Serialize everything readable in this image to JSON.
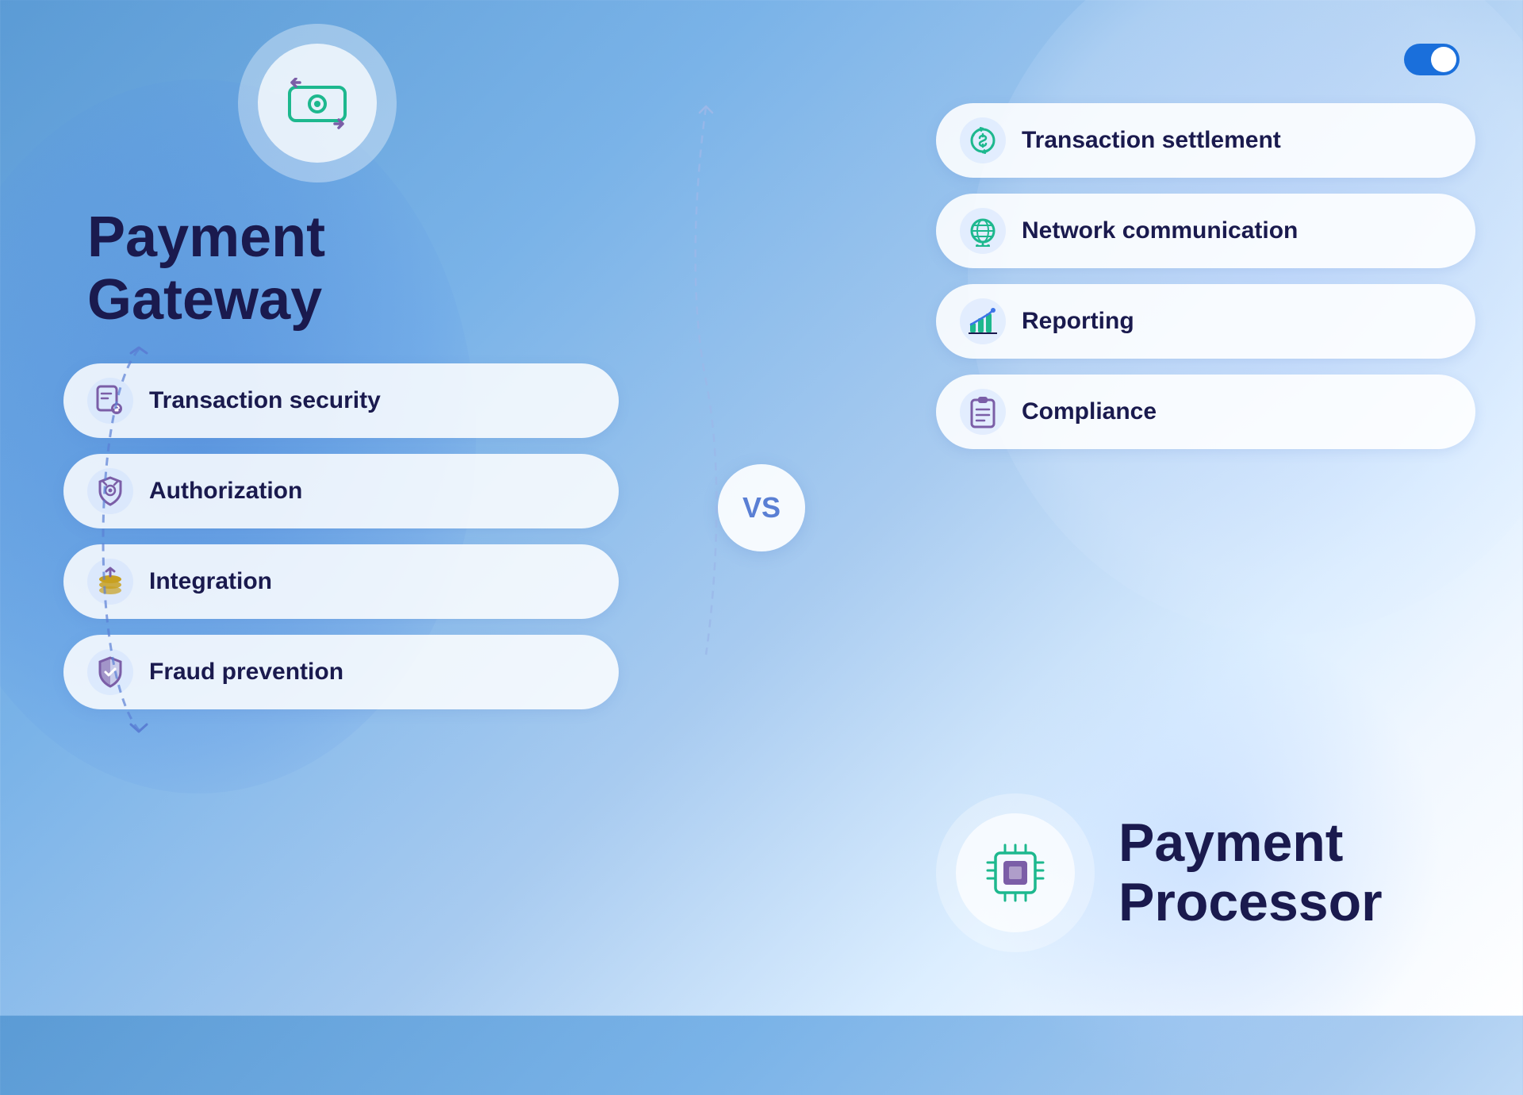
{
  "toggle": {
    "label": "toggle-icon"
  },
  "left": {
    "title_line1": "Payment",
    "title_line2": "Gateway",
    "items": [
      {
        "label": "Transaction security",
        "icon": "document-lock-icon",
        "icon_color": "#7b5ea7"
      },
      {
        "label": "Authorization",
        "icon": "shield-check-icon",
        "icon_color": "#7b5ea7"
      },
      {
        "label": "Integration",
        "icon": "layers-up-icon",
        "icon_color": "#7b5ea7"
      },
      {
        "label": "Fraud prevention",
        "icon": "shield-half-icon",
        "icon_color": "#7b5ea7"
      }
    ]
  },
  "vs_label": "VS",
  "right": {
    "items": [
      {
        "label": "Transaction settlement",
        "icon": "money-cycle-icon",
        "icon_color": "#1db88e"
      },
      {
        "label": "Network communication",
        "icon": "globe-network-icon",
        "icon_color": "#1db88e"
      },
      {
        "label": "Reporting",
        "icon": "chart-bar-icon",
        "icon_color": "#1db88e"
      },
      {
        "label": "Compliance",
        "icon": "clipboard-icon",
        "icon_color": "#7b5ea7"
      }
    ]
  },
  "processor": {
    "title_line1": "Payment",
    "title_line2": "Processor"
  },
  "colors": {
    "accent_blue": "#3d74e8",
    "accent_green": "#1db88e",
    "accent_purple": "#7b5ea7",
    "dark_navy": "#1a1a4e"
  }
}
